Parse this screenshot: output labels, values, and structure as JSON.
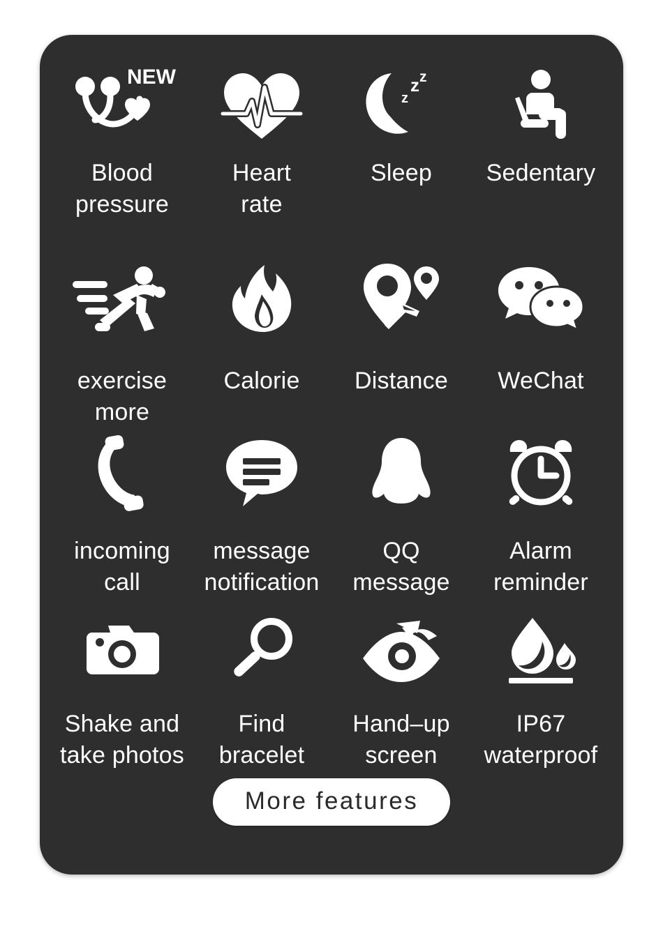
{
  "card": {
    "background_color": "#2e2e2e",
    "text_color": "#ffffff",
    "page_background": "#ffffff"
  },
  "features": [
    {
      "icon": "stethoscope-heart-icon",
      "badge": "NEW",
      "label": "Blood\npressure"
    },
    {
      "icon": "heart-pulse-icon",
      "badge": "",
      "label": "Heart\nrate"
    },
    {
      "icon": "crescent-moon-zzz-icon",
      "badge": "",
      "label": "Sleep"
    },
    {
      "icon": "seated-person-icon",
      "badge": "",
      "label": "Sedentary"
    },
    {
      "icon": "running-person-icon",
      "badge": "",
      "label": "exercise\nmore"
    },
    {
      "icon": "flame-icon",
      "badge": "",
      "label": "Calorie"
    },
    {
      "icon": "map-pin-route-icon",
      "badge": "",
      "label": "Distance"
    },
    {
      "icon": "wechat-bubbles-icon",
      "badge": "",
      "label": "WeChat"
    },
    {
      "icon": "phone-handset-icon",
      "badge": "",
      "label": "incoming\ncall"
    },
    {
      "icon": "message-bubble-icon",
      "badge": "",
      "label": "message\nnotification"
    },
    {
      "icon": "qq-penguin-icon",
      "badge": "",
      "label": "QQ\nmessage"
    },
    {
      "icon": "alarm-clock-icon",
      "badge": "",
      "label": "Alarm\nreminder"
    },
    {
      "icon": "camera-icon",
      "badge": "",
      "label": "Shake and\ntake photos"
    },
    {
      "icon": "magnifier-icon",
      "badge": "",
      "label": "Find\nbracelet"
    },
    {
      "icon": "eye-arrow-icon",
      "badge": "",
      "label": "Hand–up\nscreen"
    },
    {
      "icon": "water-drop-icon",
      "badge": "",
      "label": "IP67\nwaterproof"
    }
  ],
  "more_button": {
    "label": "More features"
  }
}
